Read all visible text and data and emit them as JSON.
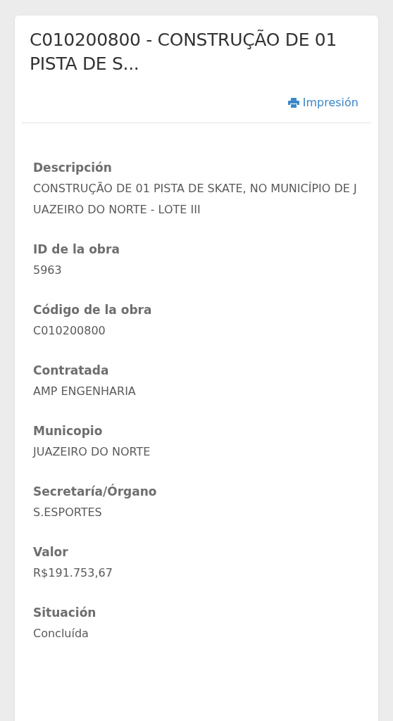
{
  "title": "C010200800 - CONSTRUÇÃO DE 01 PISTA DE S...",
  "print_link": "Impresión",
  "fields": [
    {
      "label": "Descripción",
      "value": "CONSTRUÇÃO DE 01 PISTA DE SKATE, NO MUNICÍPIO DE JUAZEIRO DO NORTE - LOTE III"
    },
    {
      "label": "ID de la obra",
      "value": "5963"
    },
    {
      "label": "Código de la obra",
      "value": "C010200800"
    },
    {
      "label": "Contratada",
      "value": "AMP ENGENHARIA"
    },
    {
      "label": "Municopio",
      "value": "JUAZEIRO DO NORTE"
    },
    {
      "label": "Secretaría/Órgano",
      "value": "S.ESPORTES"
    },
    {
      "label": "Valor",
      "value": "R$191.753,67"
    },
    {
      "label": "Situación",
      "value": "Concluída"
    }
  ]
}
